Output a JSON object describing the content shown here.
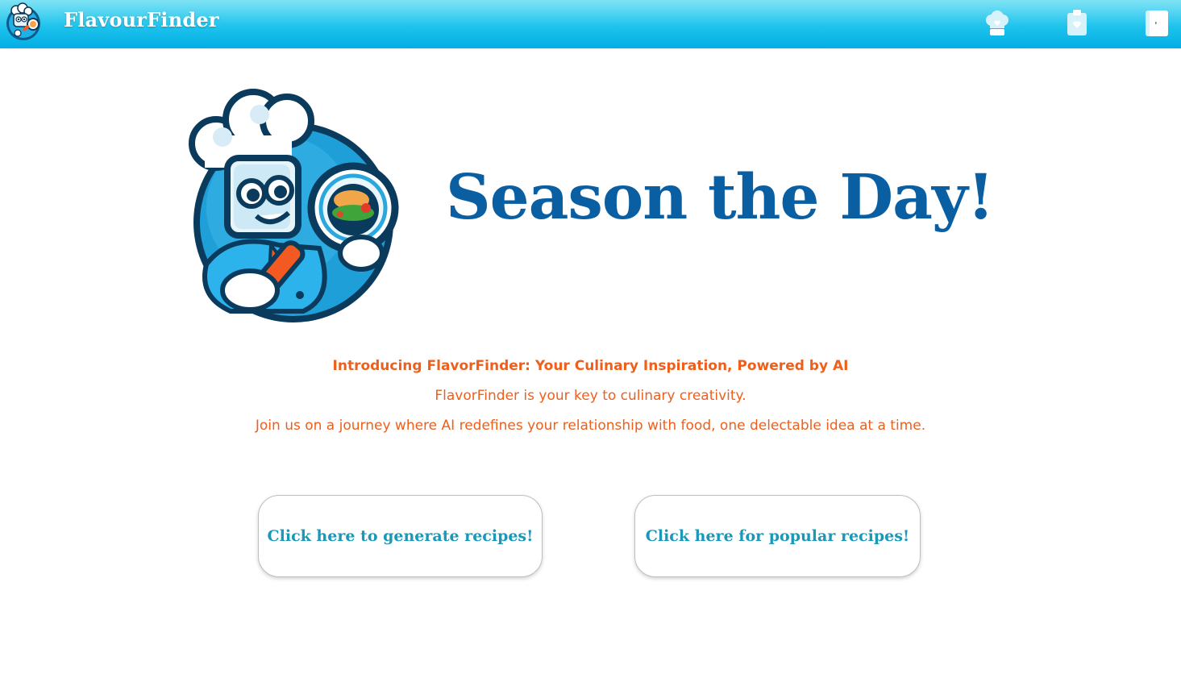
{
  "header": {
    "brand_name": "FlavourFinder",
    "icons": [
      {
        "name": "chef-hat-heart-icon"
      },
      {
        "name": "clipboard-heart-icon"
      },
      {
        "name": "logout-door-icon"
      }
    ]
  },
  "hero": {
    "title": "Season the Day!"
  },
  "intro": {
    "headline": "Introducing FlavorFinder: Your Culinary Inspiration, Powered by AI",
    "line1": "FlavorFinder is your key to culinary creativity.",
    "line2": "Join us on a journey where AI redefines your relationship with food, one delectable idea at a time."
  },
  "actions": {
    "generate_label": "Click here to generate recipes!",
    "popular_label": "Click here for popular recipes!"
  },
  "colors": {
    "header_gradient_top": "#7fe3f5",
    "header_gradient_bottom": "#03aee4",
    "title": "#0a5fa3",
    "intro_text": "#ee5f1c",
    "button_text": "#1b98b8"
  }
}
